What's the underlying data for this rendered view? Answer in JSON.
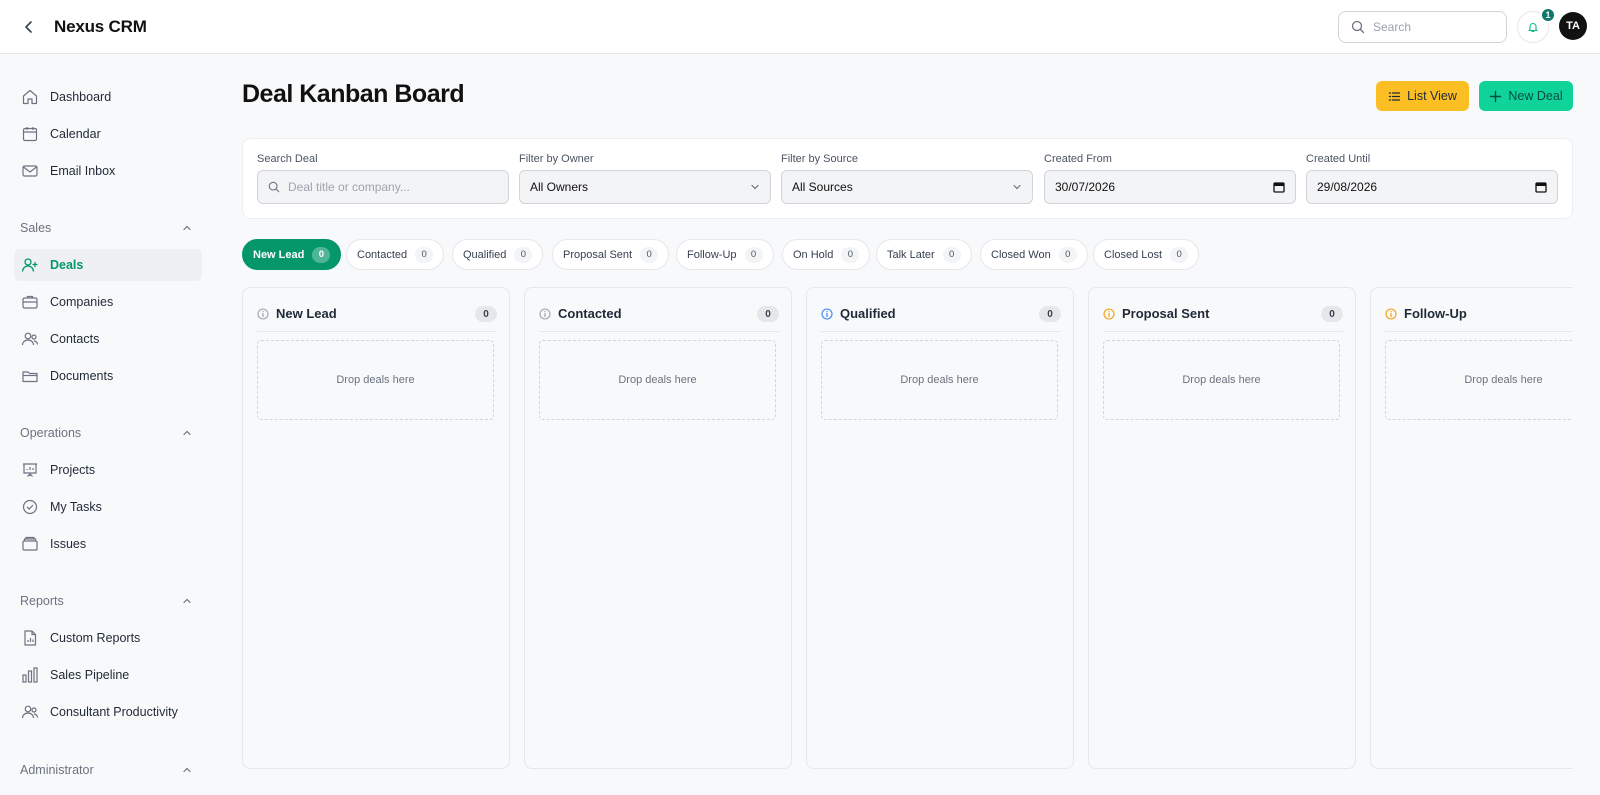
{
  "app": {
    "title": "Nexus CRM"
  },
  "topbar": {
    "search_placeholder": "Search",
    "notification_count": "1",
    "avatar_initials": "TA"
  },
  "sidebar": {
    "top_items": [
      {
        "label": "Dashboard",
        "icon": "home-icon"
      },
      {
        "label": "Calendar",
        "icon": "calendar-icon"
      },
      {
        "label": "Email Inbox",
        "icon": "mail-icon"
      }
    ],
    "sections": [
      {
        "title": "Sales",
        "items": [
          {
            "label": "Deals",
            "icon": "user-plus-icon",
            "active": true
          },
          {
            "label": "Companies",
            "icon": "briefcase-icon"
          },
          {
            "label": "Contacts",
            "icon": "users-icon"
          },
          {
            "label": "Documents",
            "icon": "folder-icon"
          }
        ]
      },
      {
        "title": "Operations",
        "items": [
          {
            "label": "Projects",
            "icon": "presentation-icon"
          },
          {
            "label": "My Tasks",
            "icon": "check-circle-icon"
          },
          {
            "label": "Issues",
            "icon": "archive-icon"
          }
        ]
      },
      {
        "title": "Reports",
        "items": [
          {
            "label": "Custom Reports",
            "icon": "file-chart-icon"
          },
          {
            "label": "Sales Pipeline",
            "icon": "bar-chart-icon"
          },
          {
            "label": "Consultant Productivity",
            "icon": "users-icon"
          }
        ]
      },
      {
        "title": "Administrator",
        "items": []
      }
    ]
  },
  "main": {
    "title": "Deal Kanban Board",
    "list_view_label": "List View",
    "new_deal_label": "New Deal",
    "filters": {
      "search_label": "Search Deal",
      "search_placeholder": "Deal title or company...",
      "owner_label": "Filter by Owner",
      "owner_value": "All Owners",
      "source_label": "Filter by Source",
      "source_value": "All Sources",
      "from_label": "Created From",
      "from_value": "30/07/2026",
      "until_label": "Created Until",
      "until_value": "29/08/2026"
    },
    "status_pills": [
      {
        "label": "New Lead",
        "count": "0",
        "active": true
      },
      {
        "label": "Contacted",
        "count": "0"
      },
      {
        "label": "Qualified",
        "count": "0"
      },
      {
        "label": "Proposal Sent",
        "count": "0"
      },
      {
        "label": "Follow-Up",
        "count": "0"
      },
      {
        "label": "On Hold",
        "count": "0"
      },
      {
        "label": "Talk Later",
        "count": "0"
      },
      {
        "label": "Closed Won",
        "count": "0"
      },
      {
        "label": "Closed Lost",
        "count": "0"
      }
    ],
    "columns": [
      {
        "title": "New Lead",
        "count": "0",
        "icon_color": "#9ca3af",
        "drop_text": "Drop deals here"
      },
      {
        "title": "Contacted",
        "count": "0",
        "icon_color": "#9ca3af",
        "drop_text": "Drop deals here"
      },
      {
        "title": "Qualified",
        "count": "0",
        "icon_color": "#3b82f6",
        "drop_text": "Drop deals here"
      },
      {
        "title": "Proposal Sent",
        "count": "0",
        "icon_color": "#f59e0b",
        "drop_text": "Drop deals here"
      },
      {
        "title": "Follow-Up",
        "count": "",
        "icon_color": "#f59e0b",
        "drop_text": "Drop deals here"
      }
    ]
  }
}
